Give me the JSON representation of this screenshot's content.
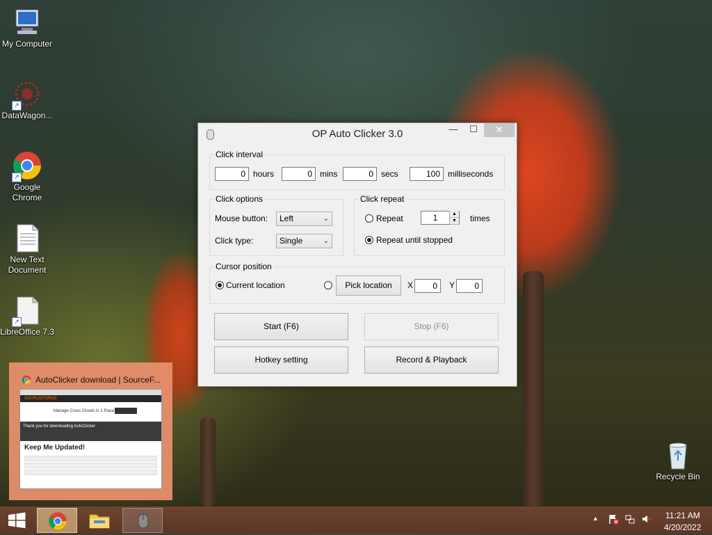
{
  "desktop": {
    "icons": [
      {
        "label": "My Computer"
      },
      {
        "label": "DataWagon..."
      },
      {
        "label": "Google Chrome"
      },
      {
        "label": "New Text Document"
      },
      {
        "label": "LibreOffice 7.3"
      },
      {
        "label": "Recycle Bin"
      }
    ]
  },
  "window": {
    "title": "OP Auto Clicker 3.0",
    "click_interval": {
      "label": "Click interval",
      "hours_value": "0",
      "hours_label": "hours",
      "mins_value": "0",
      "mins_label": "mins",
      "secs_value": "0",
      "secs_label": "secs",
      "ms_value": "100",
      "ms_label": "milliseconds"
    },
    "click_options": {
      "label": "Click options",
      "mouse_button_label": "Mouse button:",
      "mouse_button_value": "Left",
      "click_type_label": "Click type:",
      "click_type_value": "Single"
    },
    "click_repeat": {
      "label": "Click repeat",
      "repeat_label": "Repeat",
      "repeat_value": "1",
      "times_label": "times",
      "until_stopped_label": "Repeat until stopped",
      "selected": "until_stopped"
    },
    "cursor_position": {
      "label": "Cursor position",
      "current_location_label": "Current location",
      "pick_location_label": "Pick location",
      "x_label": "X",
      "x_value": "0",
      "y_label": "Y",
      "y_value": "0",
      "selected": "current"
    },
    "buttons": {
      "start": "Start (F6)",
      "stop": "Stop (F6)",
      "hotkey": "Hotkey setting",
      "record": "Record & Playback"
    }
  },
  "taskbar_preview": {
    "title": "AutoClicker download | SourceF...",
    "page_heading": "Keep Me Updated!",
    "thanks_text": "Thank you for downloading AutoClicker",
    "ad_text": "Manage Cross Clouds in 1 Place",
    "brand": "SOURCEFORGE"
  },
  "tray": {
    "time": "11:21 AM",
    "date": "4/20/2022"
  },
  "colors": {
    "taskbar": "#6e4434",
    "preview_bg": "#e88e6c",
    "close_button": "#c7c7c7"
  }
}
